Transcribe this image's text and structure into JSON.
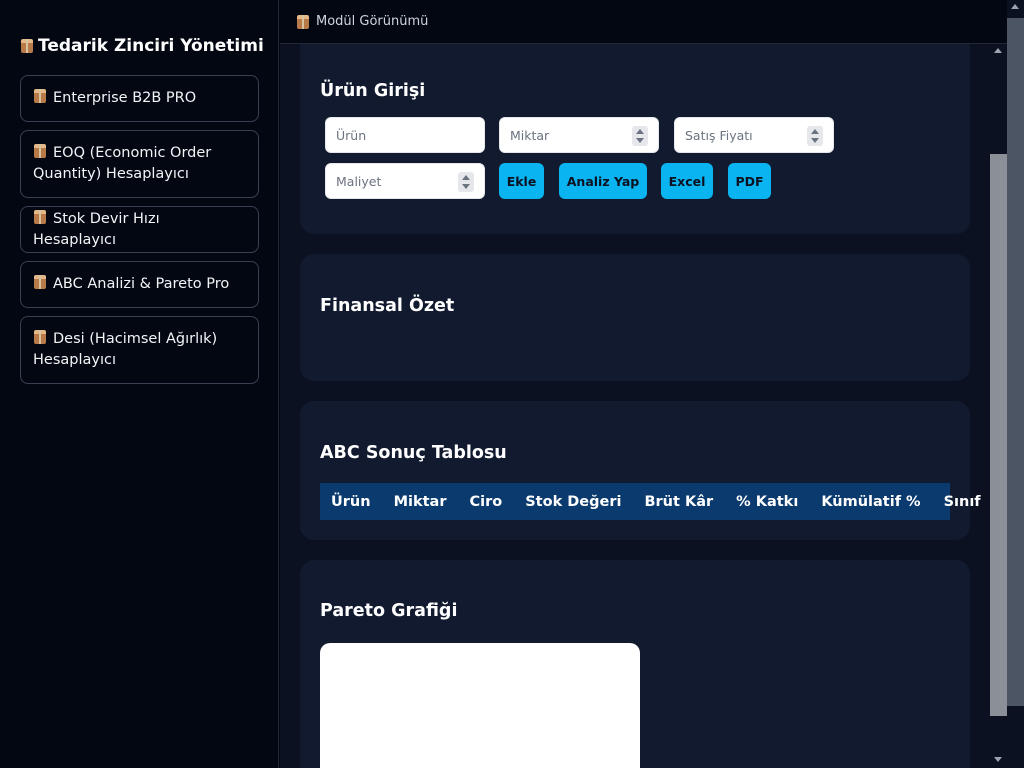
{
  "sidebar": {
    "title": "Tedarik Zinciri Yönetimi",
    "title_icon": "package-icon",
    "items": [
      {
        "icon": "package-icon",
        "label": "Enterprise B2B PRO"
      },
      {
        "icon": "package-icon",
        "label": "EOQ (Economic Order Quantity) Hesaplayıcı"
      },
      {
        "icon": "package-icon",
        "label": "Stok Devir Hızı Hesaplayıcı"
      },
      {
        "icon": "package-icon",
        "label": "ABC Analizi & Pareto Pro"
      },
      {
        "icon": "package-icon",
        "label": "Desi (Hacimsel Ağırlık) Hesaplayıcı"
      }
    ]
  },
  "topbar": {
    "title": "Modül Görünümü",
    "icon": "package-icon"
  },
  "product_entry": {
    "title": "Ürün Girişi",
    "fields": {
      "product_placeholder": "Ürün",
      "quantity_placeholder": "Miktar",
      "sale_price_placeholder": "Satış Fiyatı",
      "cost_placeholder": "Maliyet"
    },
    "buttons": {
      "add": "Ekle",
      "analyze": "Analiz Yap",
      "excel": "Excel",
      "pdf": "PDF"
    }
  },
  "financial_summary": {
    "title": "Finansal Özet"
  },
  "abc_table": {
    "title": "ABC Sonuç Tablosu",
    "columns": [
      "Ürün",
      "Miktar",
      "Ciro",
      "Stok Değeri",
      "Brüt Kâr",
      "% Katkı",
      "Kümülatif %",
      "Sınıf"
    ],
    "rows": []
  },
  "pareto": {
    "title": "Pareto Grafiği"
  },
  "colors": {
    "accent": "#0ab4f0",
    "card_bg": "#111a2e",
    "table_header_bg": "#0b3a6e",
    "page_bg": "#030712"
  }
}
